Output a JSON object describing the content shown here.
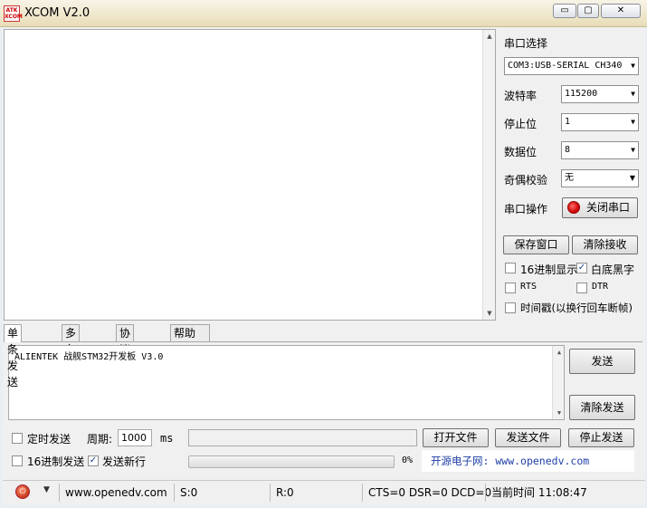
{
  "app": {
    "title": "XCOM V2.0",
    "logo_top": "ATK",
    "logo_bottom": "XCOM"
  },
  "window_controls": {
    "minimize": "▭",
    "maximize": "▢",
    "close": "✕"
  },
  "serial": {
    "port_label": "串口选择",
    "port_value": "COM3:USB-SERIAL CH340",
    "baud_label": "波特率",
    "baud_value": "115200",
    "stop_label": "停止位",
    "stop_value": "1",
    "data_label": "数据位",
    "data_value": "8",
    "parity_label": "奇偶校验",
    "parity_value": "无",
    "op_label": "串口操作",
    "op_button": "关闭串口",
    "save_window": "保存窗口",
    "clear_recv": "清除接收",
    "hex_display": "16进制显示",
    "white_black": "白底黑字",
    "rts": "RTS",
    "dtr": "DTR",
    "timestamp": "时间戳(以换行回车断帧)"
  },
  "tabs": [
    "单条发送",
    "多条发送",
    "协议传输",
    "帮助"
  ],
  "send": {
    "text": "ALIENTEK 战舰STM32开发板 V3.0",
    "send_button": "发送",
    "clear_send": "清除发送",
    "timed_send": "定时发送",
    "period_label": "周期:",
    "period_value": "1000",
    "period_unit": "ms",
    "open_file": "打开文件",
    "send_file": "发送文件",
    "stop_send": "停止发送",
    "hex_send": "16进制发送",
    "send_newline": "发送新行",
    "progress_text": "0%",
    "progress_value": 0,
    "site_banner": "开源电子网: www.openedv.com"
  },
  "status": {
    "url": "www.openedv.com",
    "sent": "S:0",
    "received": "R:0",
    "lines": "CTS=0 DSR=0 DCD=0",
    "time": "当前时间 11:08:47"
  }
}
